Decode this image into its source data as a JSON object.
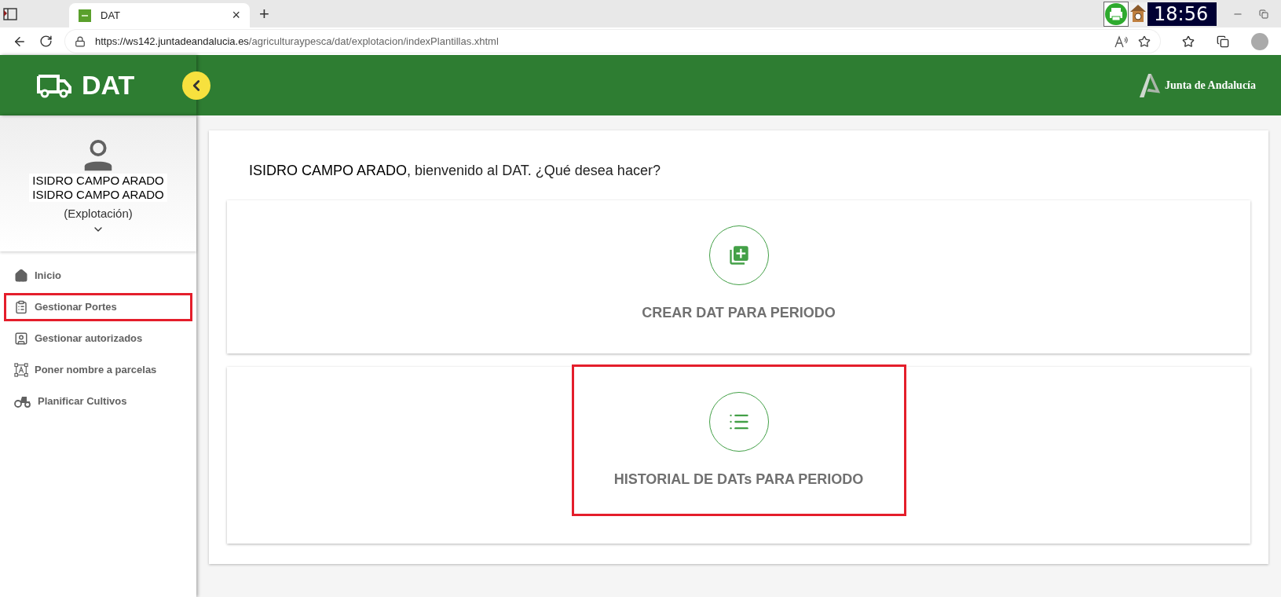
{
  "browser": {
    "tab": {
      "title": "DAT",
      "close": "×"
    },
    "new_tab": "+",
    "url": {
      "host": "https://ws142.juntadeandalucia.es",
      "path": "/agriculturaypesca/dat/explotacion/indexPlantillas.xhtml"
    },
    "clock": "18:56"
  },
  "header": {
    "app_title": "DAT",
    "brand": "Junta de Andalucía"
  },
  "user": {
    "lines": [
      "ISIDRO CAMPO ARADO",
      "ISIDRO CAMPO ARADO"
    ],
    "role": "(Explotación)"
  },
  "nav": [
    {
      "kind": "home",
      "label": "Inicio",
      "highlighted": false
    },
    {
      "kind": "clipboard",
      "label": "Gestionar Portes",
      "highlighted": true
    },
    {
      "kind": "person",
      "label": "Gestionar autorizados",
      "highlighted": false
    },
    {
      "kind": "rename",
      "label": "Poner nombre a parcelas",
      "highlighted": false
    },
    {
      "kind": "tractor",
      "label": "Planificar Cultivos",
      "highlighted": false
    }
  ],
  "welcome": {
    "name": "ISIDRO CAMPO ARADO",
    "text": ", bienvenido al DAT. ¿Qué desea hacer?"
  },
  "actions": [
    {
      "kind": "add",
      "label": "CREAR DAT PARA PERIODO",
      "highlighted": false
    },
    {
      "kind": "list",
      "label": "HISTORIAL DE DATs PARA PERIODO",
      "highlighted": true
    }
  ]
}
